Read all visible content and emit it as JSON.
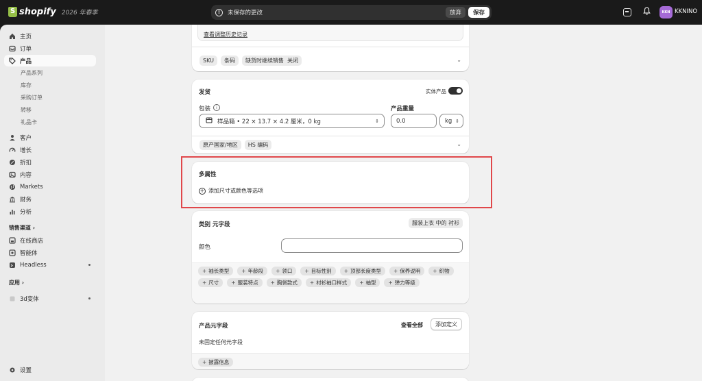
{
  "topbar": {
    "brand": "shopify",
    "edition": "2026 年春季",
    "unsaved_message": "未保存的更改",
    "discard_label": "放弃",
    "save_label": "保存",
    "avatar_initials": "KKN",
    "store_name": "KKNINO"
  },
  "sidebar": {
    "items": [
      {
        "label": "主页",
        "icon": "home-icon"
      },
      {
        "label": "订单",
        "icon": "inbox-icon"
      },
      {
        "label": "产品",
        "icon": "tag-icon",
        "active": true
      }
    ],
    "product_sub": [
      "产品系列",
      "库存",
      "采购订单",
      "转移",
      "礼品卡"
    ],
    "items2": [
      {
        "label": "客户",
        "icon": "person-icon"
      },
      {
        "label": "增长",
        "icon": "gauge-icon"
      },
      {
        "label": "折扣",
        "icon": "discount-icon"
      },
      {
        "label": "内容",
        "icon": "content-icon"
      },
      {
        "label": "Markets",
        "icon": "globe-icon"
      },
      {
        "label": "财务",
        "icon": "bank-icon"
      },
      {
        "label": "分析",
        "icon": "chart-icon"
      }
    ],
    "channels_header": "销售渠道 ›",
    "channels": [
      {
        "label": "在线商店",
        "icon": "store-icon"
      },
      {
        "label": "智能体",
        "icon": "agent-icon"
      },
      {
        "label": "Headless",
        "icon": "headless-icon"
      }
    ],
    "apps_header": "应用 ›",
    "apps": [
      {
        "label": "3d变体",
        "icon": "app-icon"
      }
    ],
    "settings_label": "设置"
  },
  "inventory_card": {
    "history_link": "查看调整历史记录",
    "chips": [
      "SKU",
      "条码",
      "缺货时继续销售"
    ],
    "continue_selling_value": "关闭"
  },
  "shipping_card": {
    "title": "发货",
    "physical_label": "实体产品",
    "package_label": "包装",
    "package_value": "样品箱 • 22 × 13.7 × 4.2 厘米，0 kg",
    "weight_label": "产品重量",
    "weight_value": "0.0",
    "weight_unit": "kg",
    "chips": [
      "原产国家/地区",
      "HS 编码"
    ]
  },
  "variants_card": {
    "title": "多属性",
    "add_label": "添加尺寸或颜色等选项"
  },
  "category_card": {
    "title": "类别 元字段",
    "category_path": "服装上衣 中的 衬衫",
    "color_label": "颜色",
    "color_value": "",
    "pills": [
      "袖长类型",
      "年龄段",
      "领口",
      "目标性别",
      "顶部长度类型",
      "保养说明",
      "织物",
      "尺寸",
      "服装特点",
      "胸袋款式",
      "衬衫袖口样式",
      "袖型",
      "弹力等级"
    ]
  },
  "product_metafields_card": {
    "title": "产品元字段",
    "view_all": "查看全部",
    "add_definition": "添加定义",
    "empty_text": "未固定任何元字段",
    "pill": "披露信息"
  }
}
